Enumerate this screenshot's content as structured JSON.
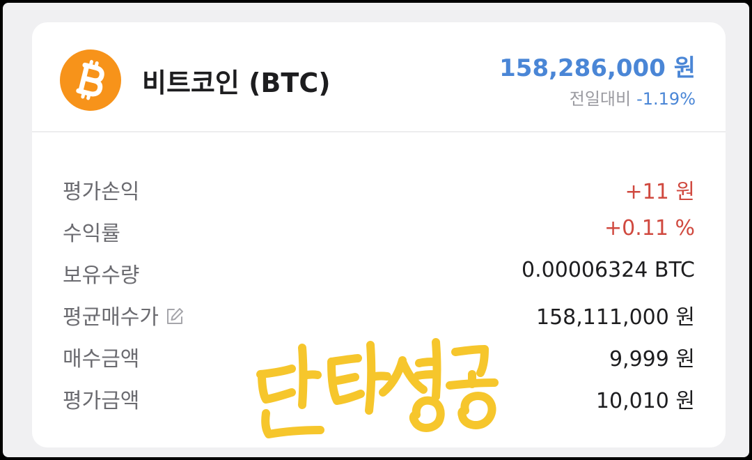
{
  "coin": {
    "name": "비트코인 (BTC)",
    "logo_icon": "bitcoin-logo-icon",
    "logo_color": "#f7931a",
    "price": "158,286,000 원",
    "change_label": "전일대비",
    "change_value": "-1.19%",
    "price_color": "#4a86d6"
  },
  "rows": [
    {
      "label": "평가손익",
      "value": "+11 원",
      "trend": "up"
    },
    {
      "label": "수익률",
      "value": "+0.11 %",
      "trend": "up"
    },
    {
      "label": "보유수량",
      "value": "0.00006324 BTC",
      "trend": "neutral"
    },
    {
      "label": "평균매수가",
      "value": "158,111,000 원",
      "trend": "neutral",
      "icon": "edit-icon"
    },
    {
      "label": "매수금액",
      "value": "9,999 원",
      "trend": "neutral"
    },
    {
      "label": "평가금액",
      "value": "10,010 원",
      "trend": "neutral"
    }
  ],
  "overlay": {
    "handwritten_text": "단타 성공",
    "color": "#f6c62c"
  },
  "colors": {
    "up": "#d0493f",
    "down": "#4a86d6"
  }
}
